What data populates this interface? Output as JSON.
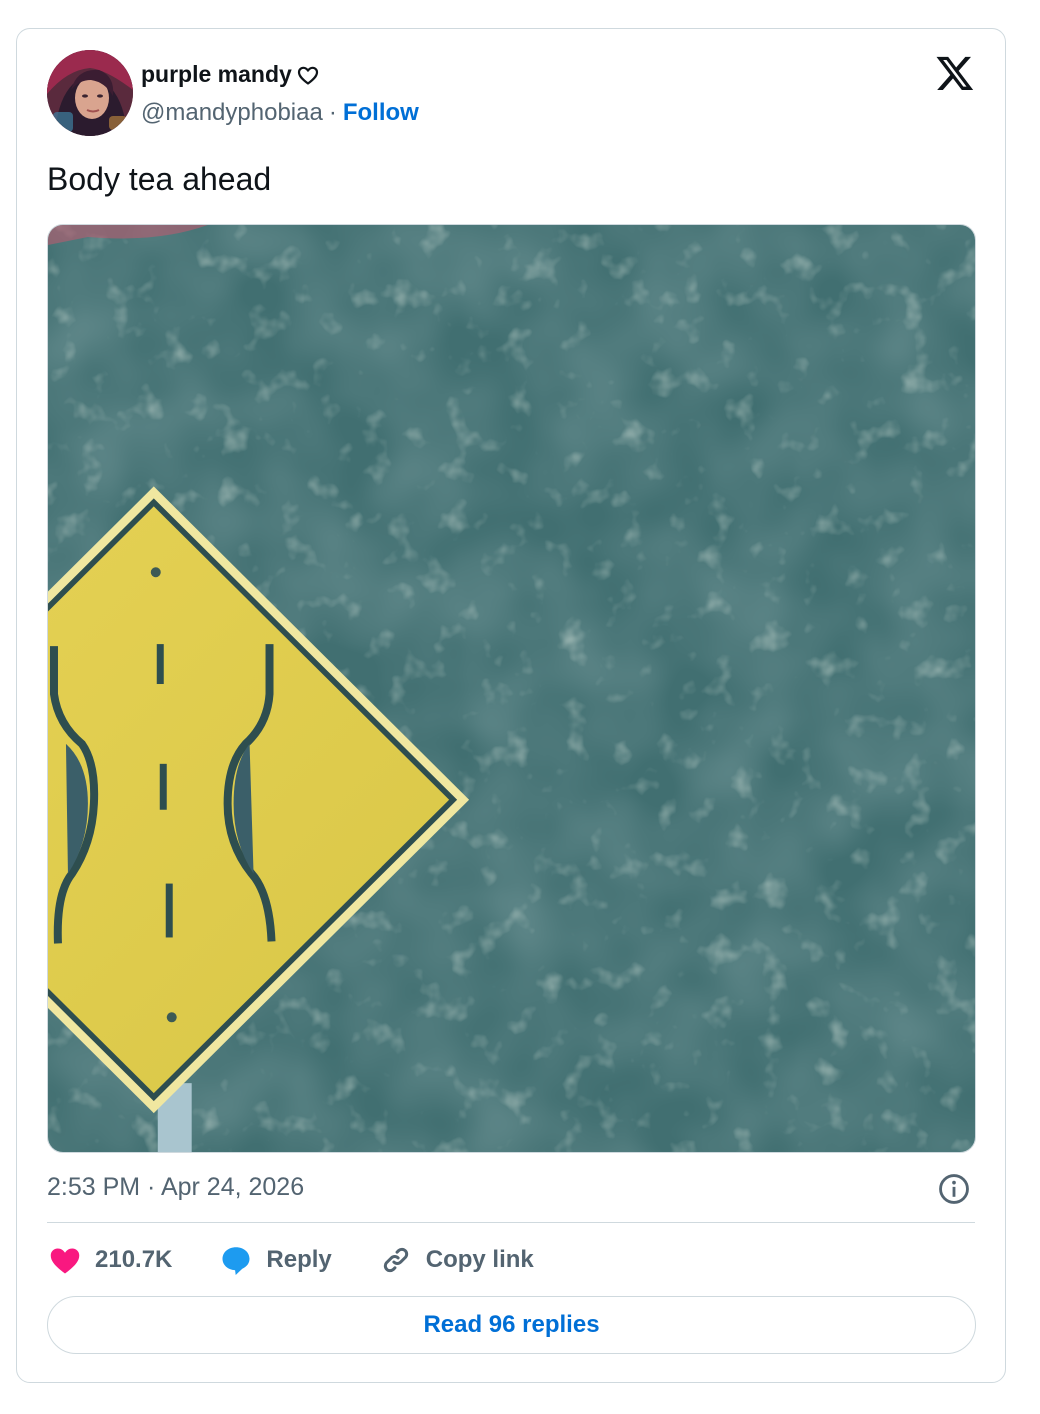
{
  "author": {
    "display_name": "purple mandy",
    "handle": "@mandyphobiaa",
    "separator": "·",
    "follow_label": "Follow"
  },
  "tweet": {
    "text": "Body tea ahead",
    "timestamp": "2:53 PM · Apr 24, 2026"
  },
  "actions": {
    "like_count": "210.7K",
    "reply_label": "Reply",
    "copy_link_label": "Copy link"
  },
  "read_replies_label": "Read 96 replies",
  "icons": {
    "logo": "x-logo-icon",
    "name_badge": "heart-outline-icon",
    "info": "info-icon",
    "like": "heart-icon",
    "reply": "speech-bubble-icon",
    "copy": "link-icon"
  },
  "colors": {
    "link_blue": "#006fd6",
    "like_pink": "#f91880",
    "reply_blue": "#1d9bf0",
    "muted_text": "#536471",
    "border": "#cfd9de",
    "sign_yellow": "#e3cf4c",
    "foliage": "#3f6b6e"
  }
}
